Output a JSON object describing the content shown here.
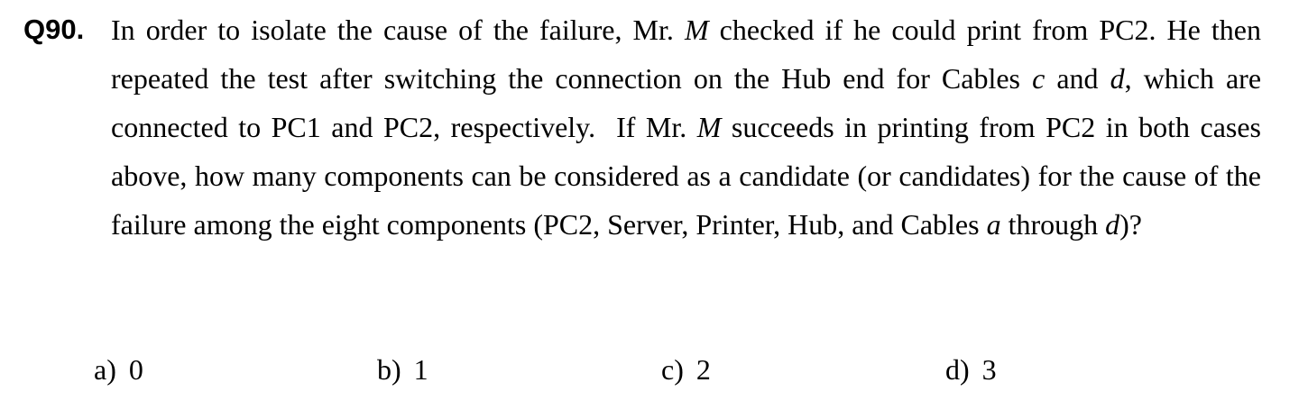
{
  "question": {
    "number": "Q90.",
    "segments": [
      {
        "text": "In order to isolate the cause of the failure, Mr. "
      },
      {
        "text": "M",
        "italic": true
      },
      {
        "text": " checked if he could print from PC2. He then repeated the test after switching the connection on the Hub end for Cables "
      },
      {
        "text": "c",
        "italic": true
      },
      {
        "text": " and "
      },
      {
        "text": "d",
        "italic": true
      },
      {
        "text": ", which are connected to PC1 and PC2, respectively.  If Mr. "
      },
      {
        "text": "M",
        "italic": true
      },
      {
        "text": " succeeds in printing from PC2 in both cases above, how many components can be considered as a candidate (or candidates) for the cause of the failure among the eight components (PC2, Server, Printer, Hub, and Cables "
      },
      {
        "text": "a",
        "italic": true
      },
      {
        "text": " through "
      },
      {
        "text": "d",
        "italic": true
      },
      {
        "text": ")?"
      }
    ]
  },
  "options": [
    {
      "label": "a)",
      "value": "0"
    },
    {
      "label": "b)",
      "value": "1"
    },
    {
      "label": "c)",
      "value": "2"
    },
    {
      "label": "d)",
      "value": "3"
    }
  ]
}
